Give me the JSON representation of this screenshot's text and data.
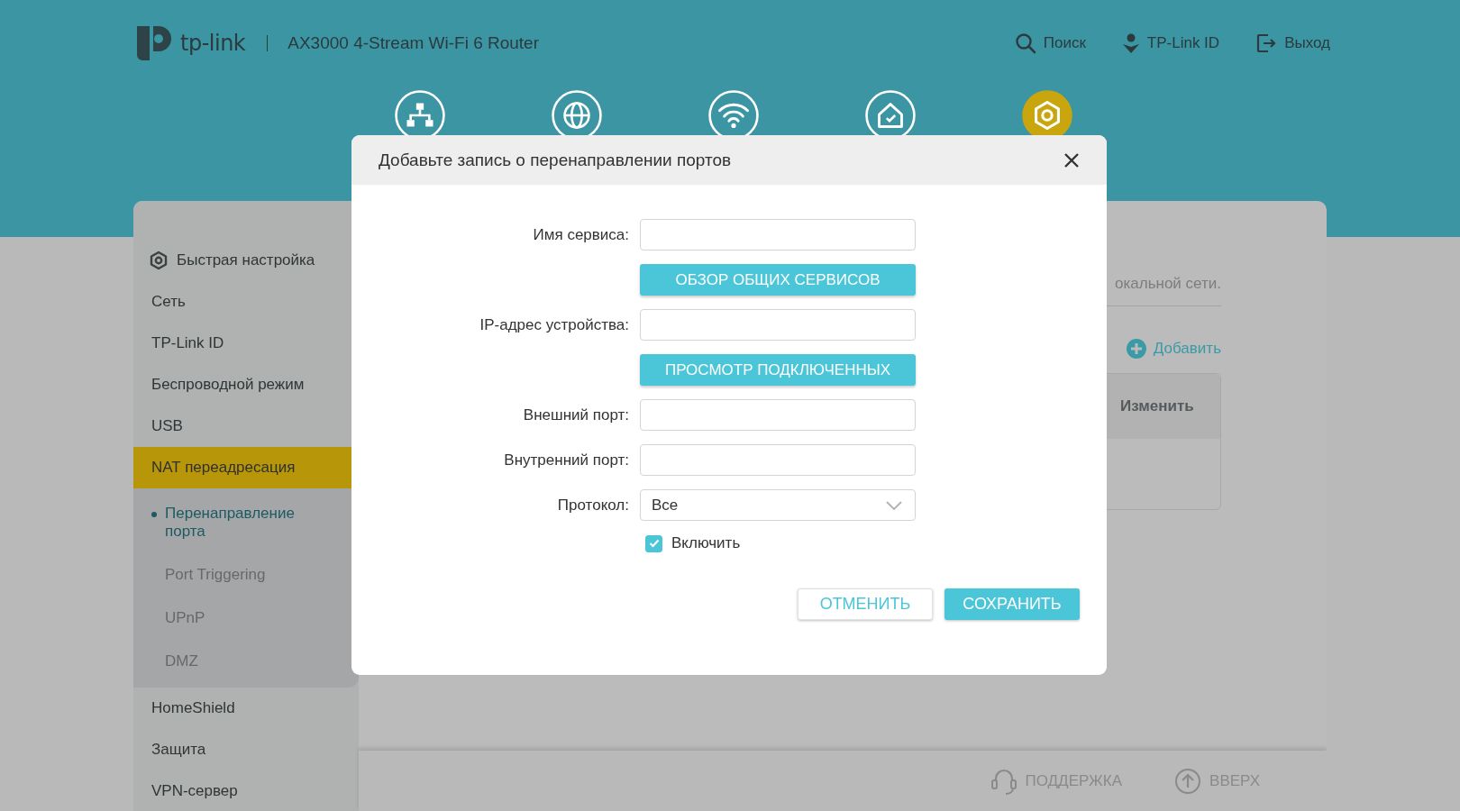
{
  "header": {
    "brand": "tp-link",
    "model": "AX3000 4-Stream Wi-Fi 6 Router",
    "links": [
      {
        "label": "Поиск",
        "kind": "search"
      },
      {
        "label": "TP-Link ID",
        "kind": "account"
      },
      {
        "label": "Выход",
        "kind": "logout"
      }
    ]
  },
  "nav_tabs": [
    {
      "kind": "network-map",
      "selected": false
    },
    {
      "kind": "internet",
      "selected": false
    },
    {
      "kind": "wireless",
      "selected": false
    },
    {
      "kind": "homeshield",
      "selected": false
    },
    {
      "kind": "advanced",
      "selected": true
    }
  ],
  "sidebar": {
    "items": [
      {
        "label": "Быстрая настройка",
        "kind": "quick-setup",
        "selected": false
      },
      {
        "label": "Сеть",
        "kind": "plain",
        "selected": false
      },
      {
        "label": "TP-Link ID",
        "kind": "plain",
        "selected": false
      },
      {
        "label": "Беспроводной режим",
        "kind": "plain",
        "selected": false
      },
      {
        "label": "USB",
        "kind": "plain",
        "selected": false
      },
      {
        "label": "NAT переадресация",
        "kind": "plain",
        "selected": true,
        "children": [
          {
            "label": "Перенаправление порта",
            "selected": true
          },
          {
            "label": "Port Triggering",
            "selected": false
          },
          {
            "label": "UPnP",
            "selected": false
          },
          {
            "label": "DMZ",
            "selected": false
          }
        ]
      },
      {
        "label": "HomeShield",
        "kind": "plain",
        "selected": false
      },
      {
        "label": "Защита",
        "kind": "plain",
        "selected": false
      },
      {
        "label": "VPN-сервер",
        "kind": "plain",
        "selected": false
      }
    ]
  },
  "content": {
    "description": "окальной сети.",
    "add_button": "Добавить",
    "table": {
      "columns": [
        "Изменить"
      ]
    }
  },
  "footer": {
    "links": [
      {
        "label": "ПОДДЕРЖКА",
        "kind": "support"
      },
      {
        "label": "ВВЕРХ",
        "kind": "top"
      }
    ]
  },
  "dialog": {
    "title": "Добавьте запись о перенаправлении портов",
    "fields": [
      {
        "kind": "text",
        "label": "Имя сервиса:"
      },
      {
        "kind": "button",
        "label": "ОБЗОР ОБЩИХ СЕРВИСОВ"
      },
      {
        "kind": "text",
        "label": "IP-адрес устройства:"
      },
      {
        "kind": "button",
        "label": "ПРОСМОТР ПОДКЛЮЧЕННЫХ"
      },
      {
        "kind": "text",
        "label": "Внешний порт:"
      },
      {
        "kind": "text",
        "label": "Внутренний порт:"
      },
      {
        "kind": "select",
        "label": "Протокол:",
        "value": "Все"
      },
      {
        "kind": "checkbox",
        "label": "Включить",
        "checked": true
      }
    ],
    "buttons": [
      {
        "label": "ОТМЕНИТЬ",
        "kind": "secondary"
      },
      {
        "label": "СОХРАНИТЬ",
        "kind": "primary"
      }
    ]
  }
}
